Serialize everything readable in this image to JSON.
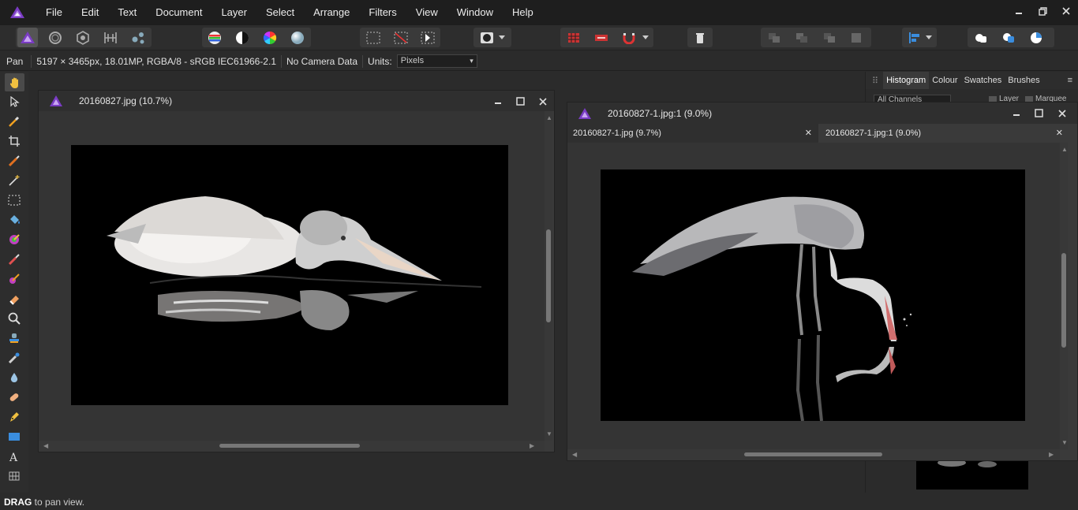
{
  "menu": [
    "File",
    "Edit",
    "Text",
    "Document",
    "Layer",
    "Select",
    "Arrange",
    "Filters",
    "View",
    "Window",
    "Help"
  ],
  "context": {
    "tool_name": "Pan",
    "image_info": "5197 × 3465px, 18.01MP, RGBA/8 - sRGB IEC61966-2.1",
    "camera": "No Camera Data",
    "units_label": "Units:",
    "units_value": "Pixels"
  },
  "doc1": {
    "title": "20160827.jpg (10.7%)"
  },
  "doc2": {
    "title": "20160827-1.jpg:1 (9.0%)",
    "tabs": [
      "20160827-1.jpg (9.7%)",
      "20160827-1.jpg:1 (9.0%)"
    ]
  },
  "panel": {
    "tabs": [
      "Histogram",
      "Colour",
      "Swatches",
      "Brushes"
    ],
    "channel_select": "All Channels",
    "layer_label": "Layer",
    "marquee_label": "Marquee"
  },
  "status": {
    "bold": "DRAG",
    "text": " to pan view."
  },
  "icons": [
    "affinity-photo-logo",
    "hand-icon",
    "move-icon",
    "brush-icon",
    "crop-icon",
    "minimize-icon",
    "maximize-icon",
    "close-icon"
  ],
  "colors": {
    "accent": "#7a3cc4",
    "menubar": "#1e1e1e",
    "panel": "#2b2b2b"
  }
}
